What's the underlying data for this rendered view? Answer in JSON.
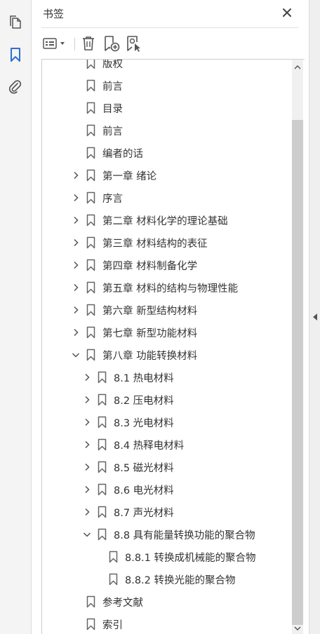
{
  "rail": {
    "items": [
      {
        "name": "pages-icon"
      },
      {
        "name": "bookmark-icon"
      },
      {
        "name": "attachment-icon"
      }
    ],
    "accent": "#2b6fd6"
  },
  "panel": {
    "title": "书签"
  },
  "toolbar": {
    "buttons": [
      "options-menu-icon",
      "delete-bookmark-icon",
      "new-bookmark-icon",
      "new-bookmark-from-structure-icon"
    ]
  },
  "bookmarks": [
    {
      "label": "版权",
      "level": 0,
      "chevron": "none"
    },
    {
      "label": "前言",
      "level": 0,
      "chevron": "none"
    },
    {
      "label": "目录",
      "level": 0,
      "chevron": "none"
    },
    {
      "label": "前言",
      "level": 0,
      "chevron": "none"
    },
    {
      "label": "编者的话",
      "level": 0,
      "chevron": "none"
    },
    {
      "label": "第一章 绪论",
      "level": 0,
      "chevron": "right"
    },
    {
      "label": "序言",
      "level": 0,
      "chevron": "right"
    },
    {
      "label": "第二章 材料化学的理论基础",
      "level": 0,
      "chevron": "right"
    },
    {
      "label": "第三章 材料结构的表征",
      "level": 0,
      "chevron": "right"
    },
    {
      "label": "第四章 材料制备化学",
      "level": 0,
      "chevron": "right"
    },
    {
      "label": "第五章 材料的结构与物理性能",
      "level": 0,
      "chevron": "right"
    },
    {
      "label": "第六章 新型结构材料",
      "level": 0,
      "chevron": "right"
    },
    {
      "label": "第七章 新型功能材料",
      "level": 0,
      "chevron": "right"
    },
    {
      "label": "第八章 功能转换材料",
      "level": 0,
      "chevron": "down"
    },
    {
      "label": "8.1 热电材料",
      "level": 1,
      "chevron": "right"
    },
    {
      "label": "8.2 压电材料",
      "level": 1,
      "chevron": "right"
    },
    {
      "label": "8.3 光电材料",
      "level": 1,
      "chevron": "right"
    },
    {
      "label": "8.4 热释电材料",
      "level": 1,
      "chevron": "right"
    },
    {
      "label": "8.5 磁光材料",
      "level": 1,
      "chevron": "right"
    },
    {
      "label": "8.6 电光材料",
      "level": 1,
      "chevron": "right"
    },
    {
      "label": "8.7 声光材料",
      "level": 1,
      "chevron": "right"
    },
    {
      "label": "8.8 具有能量转换功能的聚合物",
      "level": 1,
      "chevron": "down"
    },
    {
      "label": "8.8.1 转换成机械能的聚合物",
      "level": 2,
      "chevron": "none"
    },
    {
      "label": "8.8.2 转换光能的聚合物",
      "level": 2,
      "chevron": "none"
    },
    {
      "label": "参考文献",
      "level": 0,
      "chevron": "none"
    },
    {
      "label": "索引",
      "level": 0,
      "chevron": "none"
    }
  ]
}
